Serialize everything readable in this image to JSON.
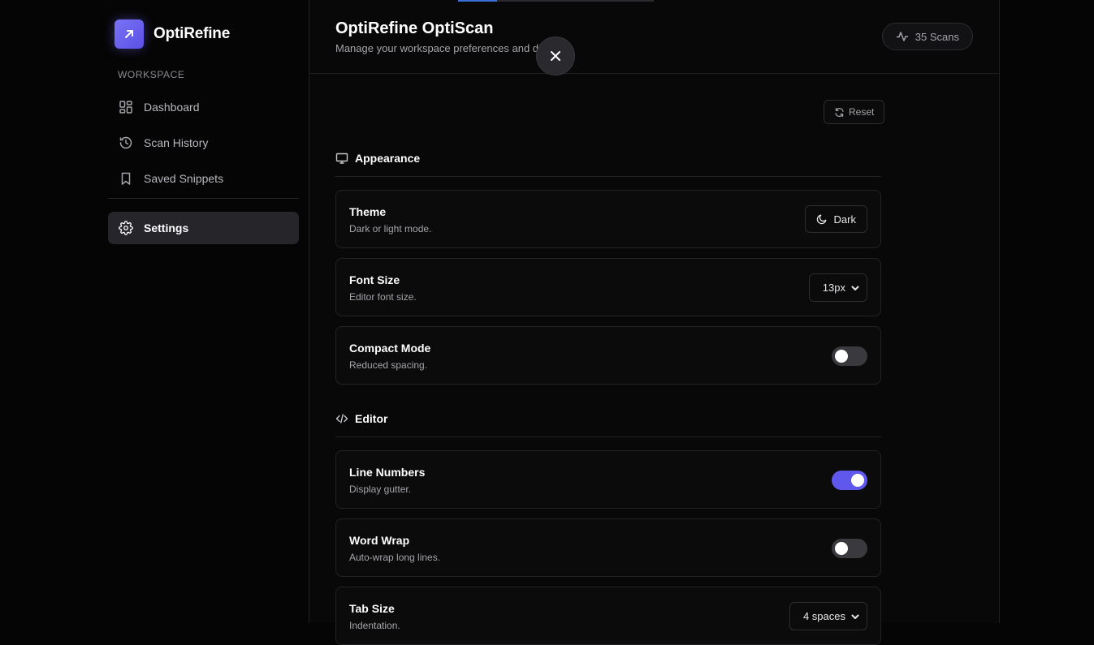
{
  "brand": {
    "name": "OptiRefine",
    "logo_icon": "arrow-up-right-icon",
    "accent": "#6058ec"
  },
  "sidebar": {
    "section_label": "WORKSPACE",
    "items": [
      {
        "label": "Dashboard",
        "icon": "grid-icon"
      },
      {
        "label": "Scan History",
        "icon": "history-icon"
      },
      {
        "label": "Saved Snippets",
        "icon": "bookmark-icon"
      },
      {
        "label": "Settings",
        "icon": "gear-icon",
        "active": true
      }
    ]
  },
  "header": {
    "title": "OptiRefine OptiScan",
    "subtitle": "Manage your workspace preferences and d",
    "scans": "35 Scans"
  },
  "actions": {
    "reset": "Reset"
  },
  "appearance": {
    "title": "Appearance",
    "theme": {
      "title": "Theme",
      "desc": "Dark or light mode.",
      "value": "Dark"
    },
    "font_size": {
      "title": "Font Size",
      "desc": "Editor font size.",
      "value": "13px"
    },
    "compact": {
      "title": "Compact Mode",
      "desc": "Reduced spacing.",
      "enabled": false
    }
  },
  "editor": {
    "title": "Editor",
    "line_numbers": {
      "title": "Line Numbers",
      "desc": "Display gutter.",
      "enabled": true
    },
    "word_wrap": {
      "title": "Word Wrap",
      "desc": "Auto-wrap long lines.",
      "enabled": false
    },
    "tab_size": {
      "title": "Tab Size",
      "desc": "Indentation.",
      "value": "4 spaces"
    }
  },
  "top_progress": 0.2
}
